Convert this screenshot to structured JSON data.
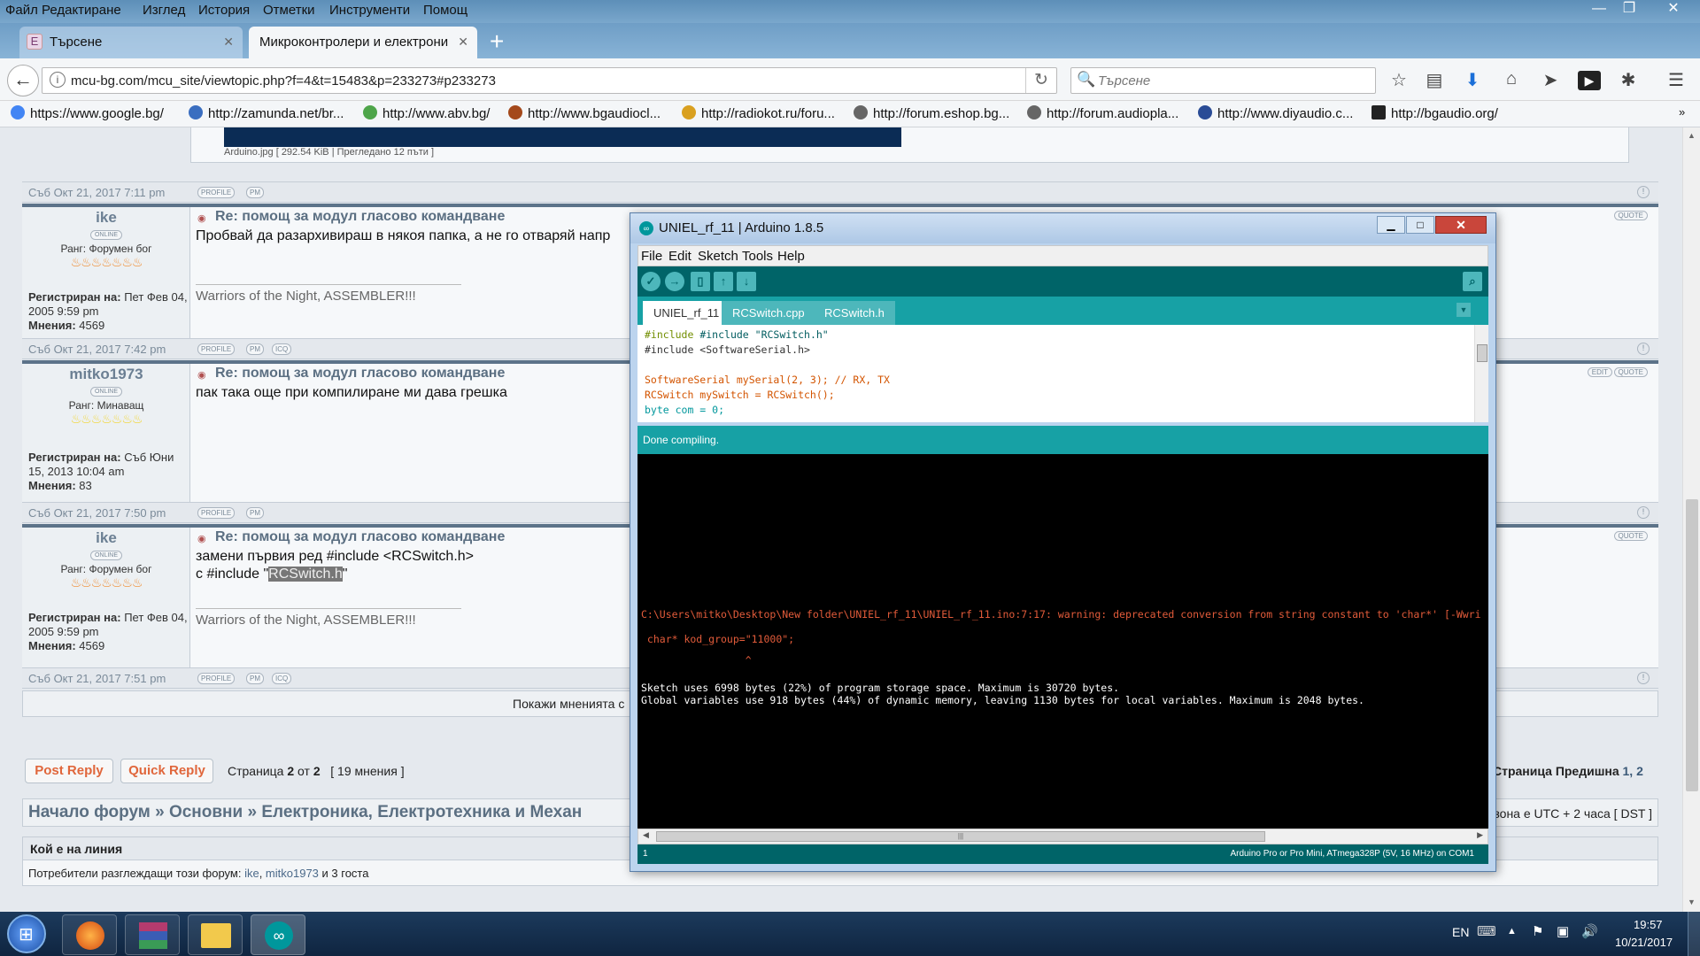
{
  "firefox": {
    "menu": [
      "Файл",
      "Редактиране",
      "Изглед",
      "История",
      "Отметки",
      "Инструменти",
      "Помощ"
    ],
    "tabs": [
      {
        "label": "Търсене"
      },
      {
        "label": "Микроконтролери и електрони"
      }
    ],
    "url": "mcu-bg.com/mcu_site/viewtopic.php?f=4&t=15483&p=233273#p233273",
    "search_placeholder": "Търсене",
    "bookmarks": [
      "https://www.google.bg/",
      "http://zamunda.net/br...",
      "http://www.abv.bg/",
      "http://www.bgaudiocl...",
      "http://radiokot.ru/foru...",
      "http://forum.eshop.bg...",
      "http://forum.audiopla...",
      "http://www.diyaudio.c...",
      "http://bgaudio.org/"
    ]
  },
  "forum": {
    "attachment_caption": "Arduino.jpg [ 292.54 KiB | Прегледано 12 пъти ]",
    "first_footer_date": "Съб Окт 21, 2017 7:11 pm",
    "buttons": {
      "profile": "PROFILE",
      "pm": "PM",
      "icq": "ICQ",
      "quote": "QUOTE",
      "edit": "EDIT",
      "online": "ONLINE"
    },
    "posts": [
      {
        "author": "ike",
        "rank": "Ранг: Форумен бог",
        "reg_label": "Регистриран на:",
        "reg": "Пет Фев 04, 2005 9:59 pm",
        "posts_label": "Мнения:",
        "posts": "4569",
        "title": "Re: помощ за модул гласово командване",
        "text": "Пробвай да разархивираш в някоя папка, а не го отваряй напр",
        "sig": "Warriors of the Night, ASSEMBLER!!!",
        "date": "Съб Окт 21, 2017 7:42 pm"
      },
      {
        "author": "mitko1973",
        "rank": "Ранг: Минаващ",
        "reg_label": "Регистриран на:",
        "reg": "Съб Юни 15, 2013 10:04 am",
        "posts_label": "Мнения:",
        "posts": "83",
        "title": "Re: помощ за модул гласово командване",
        "text": "пак така още при компилиране ми дава грешка",
        "date": "Съб Окт 21, 2017 7:50 pm"
      },
      {
        "author": "ike",
        "rank": "Ранг: Форумен бог",
        "reg_label": "Регистриран на:",
        "reg": "Пет Фев 04, 2005 9:59 pm",
        "posts_label": "Мнения:",
        "posts": "4569",
        "title": "Re: помощ за модул гласово командване",
        "text_line1": "замени първия ред #include <RCSwitch.h>",
        "text_line2_pre": "с #include \"",
        "text_line2_sel": "RCSwitch.h",
        "text_line2_post": "\"",
        "sig": "Warriors of the Night, ASSEMBLER!!!",
        "date": "Съб Окт 21, 2017 7:51 pm"
      }
    ],
    "show_posts": "Покажи мненията с",
    "post_reply": "Post Reply",
    "quick_reply": "Quick Reply",
    "page_pre": "Страница ",
    "page_cur": "2",
    "page_mid": " от ",
    "page_total": "2",
    "page_count": "[ 19 мнения ]",
    "pagination_right_pre": "Страница Предишна ",
    "pagination_right_nums": "1, 2",
    "breadcrumb": "Начало форум » Основни » Електроника, Електротехника и Механ",
    "timezone": "Часовата зона е UTC + 2 часа [ DST ]",
    "who_online_title": "Кой е на линия",
    "who_online_pre": "Потребители разглеждащи този форум: ",
    "who_online_u1": "ike",
    "who_online_sep": ", ",
    "who_online_u2": "mitko1973",
    "who_online_post": " и 3 госта"
  },
  "arduino": {
    "title": "UNIEL_rf_11 | Arduino 1.8.5",
    "menu": [
      "File",
      "Edit",
      "Sketch",
      "Tools",
      "Help"
    ],
    "tabs": [
      "UNIEL_rf_11",
      "RCSwitch.cpp",
      "RCSwitch.h"
    ],
    "code": [
      "#include \"RCSwitch.h\"",
      "#include <SoftwareSerial.h>",
      "",
      "SoftwareSerial mySerial(2, 3); // RX, TX",
      "RCSwitch mySwitch = RCSwitch();",
      "byte com = 0;"
    ],
    "status": "Done compiling.",
    "console": {
      "warning": "C:\\Users\\mitko\\Desktop\\New folder\\UNIEL_rf_11\\UNIEL_rf_11.ino:7:17: warning: deprecated conversion from string constant to 'char*' [-Wwri",
      "line2": " char* kod_group=\"11000\";",
      "caret": "                 ^",
      "sketch": "Sketch uses 6998 bytes (22%) of program storage space. Maximum is 30720 bytes.",
      "globals": "Global variables use 918 bytes (44%) of dynamic memory, leaving 1130 bytes for local variables. Maximum is 2048 bytes."
    },
    "footer_line": "1",
    "board": "Arduino Pro or Pro Mini, ATmega328P (5V, 16 MHz) on COM1"
  },
  "taskbar": {
    "lang": "EN",
    "time": "19:57",
    "date": "10/21/2017"
  }
}
